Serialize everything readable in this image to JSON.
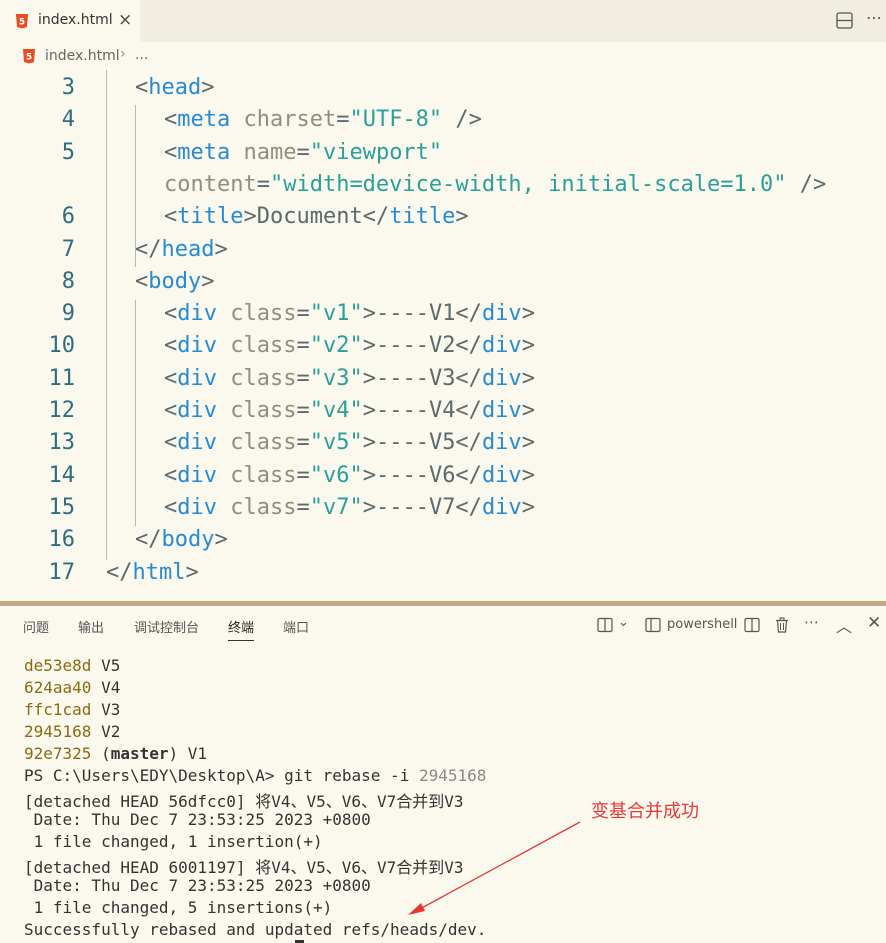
{
  "tab": {
    "label": "index.html",
    "close": "×"
  },
  "breadcrumb": {
    "file": "index.html",
    "sep": "›",
    "more": "..."
  },
  "editor": {
    "line_numbers": [
      "3",
      "4",
      "5",
      "",
      "6",
      "7",
      "8",
      "9",
      "10",
      "11",
      "12",
      "13",
      "14",
      "15",
      "16",
      "17"
    ],
    "lines": [
      {
        "indent": 1,
        "parts": [
          [
            "p",
            "<"
          ],
          [
            "t",
            "head"
          ],
          [
            "p",
            ">"
          ]
        ]
      },
      {
        "indent": 2,
        "parts": [
          [
            "p",
            "<"
          ],
          [
            "t",
            "meta"
          ],
          [
            "p",
            " "
          ],
          [
            "a",
            "charset"
          ],
          [
            "p",
            "="
          ],
          [
            "s",
            "\"UTF-8\""
          ],
          [
            "p",
            " />"
          ]
        ]
      },
      {
        "indent": 2,
        "parts": [
          [
            "p",
            "<"
          ],
          [
            "t",
            "meta"
          ],
          [
            "p",
            " "
          ],
          [
            "a",
            "name"
          ],
          [
            "p",
            "="
          ],
          [
            "s",
            "\"viewport\""
          ]
        ]
      },
      {
        "indent": 2,
        "parts": [
          [
            "a",
            "content"
          ],
          [
            "p",
            "="
          ],
          [
            "s",
            "\"width=device-width, initial-scale=1.0\""
          ],
          [
            "p",
            " />"
          ]
        ]
      },
      {
        "indent": 2,
        "parts": [
          [
            "p",
            "<"
          ],
          [
            "t",
            "title"
          ],
          [
            "p",
            ">Document</"
          ],
          [
            "t",
            "title"
          ],
          [
            "p",
            ">"
          ]
        ]
      },
      {
        "indent": 1,
        "parts": [
          [
            "p",
            "</"
          ],
          [
            "t",
            "head"
          ],
          [
            "p",
            ">"
          ]
        ]
      },
      {
        "indent": 1,
        "parts": [
          [
            "p",
            "<"
          ],
          [
            "t",
            "body"
          ],
          [
            "p",
            ">"
          ]
        ]
      },
      {
        "indent": 2,
        "parts": [
          [
            "p",
            "<"
          ],
          [
            "t",
            "div"
          ],
          [
            "p",
            " "
          ],
          [
            "a",
            "class"
          ],
          [
            "p",
            "="
          ],
          [
            "s",
            "\"v1\""
          ],
          [
            "p",
            ">----V1</"
          ],
          [
            "t",
            "div"
          ],
          [
            "p",
            ">"
          ]
        ]
      },
      {
        "indent": 2,
        "parts": [
          [
            "p",
            "<"
          ],
          [
            "t",
            "div"
          ],
          [
            "p",
            " "
          ],
          [
            "a",
            "class"
          ],
          [
            "p",
            "="
          ],
          [
            "s",
            "\"v2\""
          ],
          [
            "p",
            ">----V2</"
          ],
          [
            "t",
            "div"
          ],
          [
            "p",
            ">"
          ]
        ]
      },
      {
        "indent": 2,
        "parts": [
          [
            "p",
            "<"
          ],
          [
            "t",
            "div"
          ],
          [
            "p",
            " "
          ],
          [
            "a",
            "class"
          ],
          [
            "p",
            "="
          ],
          [
            "s",
            "\"v3\""
          ],
          [
            "p",
            ">----V3</"
          ],
          [
            "t",
            "div"
          ],
          [
            "p",
            ">"
          ]
        ]
      },
      {
        "indent": 2,
        "parts": [
          [
            "p",
            "<"
          ],
          [
            "t",
            "div"
          ],
          [
            "p",
            " "
          ],
          [
            "a",
            "class"
          ],
          [
            "p",
            "="
          ],
          [
            "s",
            "\"v4\""
          ],
          [
            "p",
            ">----V4</"
          ],
          [
            "t",
            "div"
          ],
          [
            "p",
            ">"
          ]
        ]
      },
      {
        "indent": 2,
        "parts": [
          [
            "p",
            "<"
          ],
          [
            "t",
            "div"
          ],
          [
            "p",
            " "
          ],
          [
            "a",
            "class"
          ],
          [
            "p",
            "="
          ],
          [
            "s",
            "\"v5\""
          ],
          [
            "p",
            ">----V5</"
          ],
          [
            "t",
            "div"
          ],
          [
            "p",
            ">"
          ]
        ]
      },
      {
        "indent": 2,
        "parts": [
          [
            "p",
            "<"
          ],
          [
            "t",
            "div"
          ],
          [
            "p",
            " "
          ],
          [
            "a",
            "class"
          ],
          [
            "p",
            "="
          ],
          [
            "s",
            "\"v6\""
          ],
          [
            "p",
            ">----V6</"
          ],
          [
            "t",
            "div"
          ],
          [
            "p",
            ">"
          ]
        ]
      },
      {
        "indent": 2,
        "parts": [
          [
            "p",
            "<"
          ],
          [
            "t",
            "div"
          ],
          [
            "p",
            " "
          ],
          [
            "a",
            "class"
          ],
          [
            "p",
            "="
          ],
          [
            "s",
            "\"v7\""
          ],
          [
            "p",
            ">----V7</"
          ],
          [
            "t",
            "div"
          ],
          [
            "p",
            ">"
          ]
        ]
      },
      {
        "indent": 1,
        "parts": [
          [
            "p",
            "</"
          ],
          [
            "t",
            "body"
          ],
          [
            "p",
            ">"
          ]
        ]
      },
      {
        "indent": 0,
        "parts": [
          [
            "p",
            "</"
          ],
          [
            "t",
            "html"
          ],
          [
            "p",
            ">"
          ]
        ]
      }
    ]
  },
  "panel": {
    "tabs": [
      "问题",
      "输出",
      "调试控制台",
      "终端",
      "端口"
    ],
    "active_tab": "终端",
    "shell": "powershell",
    "icons": [
      "split-terminal-icon",
      "chevron-down-icon",
      "terminal-icon",
      "split-icon",
      "trash-icon",
      "more-icon",
      "maximize-icon",
      "close-icon"
    ]
  },
  "terminal": {
    "commits": [
      {
        "hash": "de53e8d",
        "msg": " V5"
      },
      {
        "hash": "624aa40",
        "msg": " V4"
      },
      {
        "hash": "ffc1cad",
        "msg": " V3"
      },
      {
        "hash": "2945168",
        "msg": " V2"
      },
      {
        "hash": "92e7325",
        "pre": " (",
        "branch": "master",
        "post": ") V1"
      }
    ],
    "prompt": "PS C:\\Users\\EDY\\Desktop\\A> ",
    "command": "git rebase -i ",
    "command_arg": "2945168",
    "output": [
      "[detached HEAD 56dfcc0] 将V4、V5、V6、V7合并到V3",
      " Date: Thu Dec 7 23:53:25 2023 +0800",
      " 1 file changed, 1 insertion(+)",
      "[detached HEAD 6001197] 将V4、V5、V6、V7合并到V3",
      " Date: Thu Dec 7 23:53:25 2023 +0800",
      " 1 file changed, 5 insertions(+)",
      "Successfully rebased and updated refs/heads/dev."
    ]
  },
  "annotation": {
    "text": "变基合并成功",
    "color": "#e53935"
  }
}
